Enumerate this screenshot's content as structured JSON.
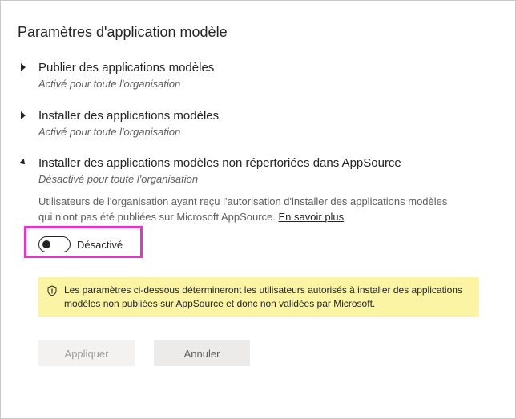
{
  "page_title": "Paramètres d'application modèle",
  "settings": [
    {
      "title": "Publier des applications modèles",
      "status": "Activé pour toute l'organisation",
      "expanded": false
    },
    {
      "title": "Installer des applications modèles",
      "status": "Activé pour toute l'organisation",
      "expanded": false
    },
    {
      "title": "Installer des applications modèles non répertoriées dans AppSource",
      "status": "Désactivé pour toute l'organisation",
      "expanded": true
    }
  ],
  "description": {
    "text": "Utilisateurs de l'organisation ayant reçu l'autorisation d'installer des applications modèles qui n'ont pas été publiées sur Microsoft AppSource.",
    "link": "En savoir plus",
    "after_link": "."
  },
  "toggle": {
    "label": "Désactivé",
    "on": false
  },
  "warning": {
    "icon": "shield-icon",
    "text": "Les paramètres ci-dessous détermineront les utilisateurs autorisés à installer des applications modèles non publiées sur AppSource et donc non validées par Microsoft."
  },
  "buttons": {
    "apply": "Appliquer",
    "cancel": "Annuler"
  },
  "colors": {
    "highlight": "#e535c8",
    "warning_bg": "#fbf4a5"
  }
}
